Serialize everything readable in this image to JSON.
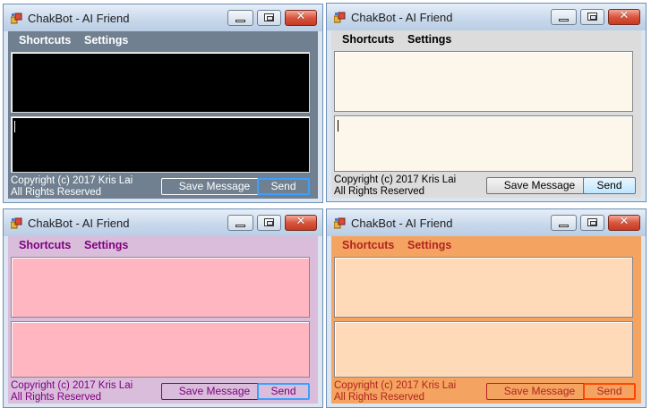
{
  "windows": [
    {
      "theme": "dark",
      "title": "ChakBot - AI Friend",
      "menu": [
        "Shortcuts",
        "Settings"
      ],
      "copyright_line1": "Copyright (c) 2017 Kris Lai",
      "copyright_line2": "All Rights Reserved",
      "save_label": "Save Message",
      "send_label": "Send",
      "colors": {
        "background": "#708090",
        "text": "#ffffff",
        "textbox": "#000000"
      }
    },
    {
      "theme": "default",
      "title": "ChakBot - AI Friend",
      "menu": [
        "Shortcuts",
        "Settings"
      ],
      "copyright_line1": "Copyright (c) 2017 Kris Lai",
      "copyright_line2": "All Rights Reserved",
      "save_label": "Save Message",
      "send_label": "Send",
      "colors": {
        "background": "#dcdcdc",
        "text": "#000000",
        "textbox": "#fdf6ea"
      }
    },
    {
      "theme": "pink",
      "title": "ChakBot - AI Friend",
      "menu": [
        "Shortcuts",
        "Settings"
      ],
      "copyright_line1": "Copyright (c) 2017 Kris Lai",
      "copyright_line2": "All Rights Reserved",
      "save_label": "Save Message",
      "send_label": "Send",
      "colors": {
        "background": "#d9bddb",
        "text": "#800080",
        "textbox": "#ffb6c1"
      }
    },
    {
      "theme": "orange",
      "title": "ChakBot - AI Friend",
      "menu": [
        "Shortcuts",
        "Settings"
      ],
      "copyright_line1": "Copyright (c) 2017 Kris Lai",
      "copyright_line2": "All Rights Reserved",
      "save_label": "Save Message",
      "send_label": "Send",
      "colors": {
        "background": "#f4a460",
        "text": "#b22222",
        "textbox": "#ffdab9"
      }
    }
  ],
  "icons": {
    "app": "app-icon",
    "minimize": "minimize-icon",
    "maximize": "maximize-icon",
    "close": "close-icon",
    "close_glyph": "✕"
  }
}
